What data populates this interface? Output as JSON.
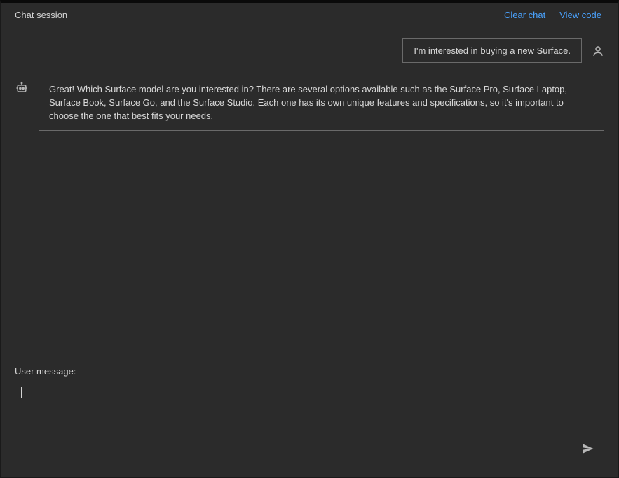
{
  "header": {
    "title": "Chat session",
    "clear_label": "Clear chat",
    "view_code_label": "View code"
  },
  "messages": {
    "user_1": "I'm interested in buying a new Surface.",
    "bot_1": "Great! Which Surface model are you interested in? There are several options available such as the Surface Pro, Surface Laptop, Surface Book, Surface Go, and the Surface Studio. Each one has its own unique features and specifications, so it's important to choose the one that best fits your needs."
  },
  "input": {
    "label": "User message:",
    "value": ""
  }
}
